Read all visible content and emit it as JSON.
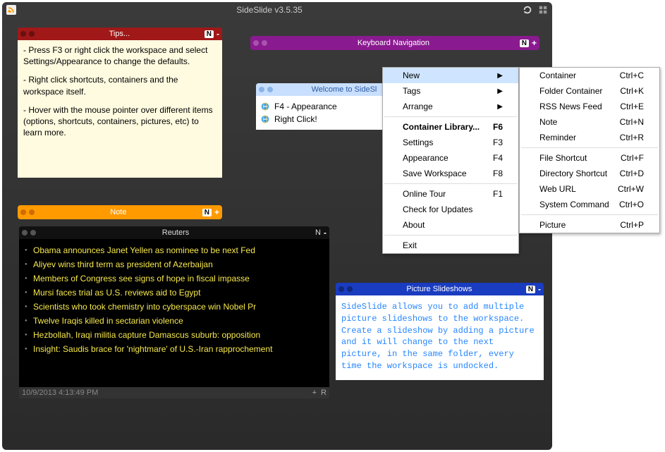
{
  "app": {
    "title": "SideSlide v3.5.35"
  },
  "tips": {
    "title": "Tips...",
    "badge": "N",
    "sign": "-",
    "paragraphs": [
      "- Press F3 or right click the workspace and select Settings/Appearance to change the defaults.",
      "- Right click shortcuts, containers and the workspace itself.",
      "- Hover with the mouse pointer over different items (options, shortcuts, containers, pictures, etc) to learn more."
    ]
  },
  "kbnav": {
    "title": "Keyboard Navigation",
    "badge": "N",
    "sign": "+"
  },
  "welcome": {
    "title": "Welcome to SideSl",
    "items": [
      {
        "label": "F4 - Appearance"
      },
      {
        "label": "Right Click!"
      }
    ]
  },
  "notebar": {
    "title": "Note",
    "badge": "N",
    "sign": "+"
  },
  "reuters": {
    "title": "Reuters",
    "badge": "N",
    "sign": "-",
    "items": [
      "Obama announces Janet Yellen as nominee to be next Fed",
      "Aliyev wins third term as president of Azerbaijan",
      "Members of Congress see signs of hope in fiscal impasse",
      "Mursi faces trial as U.S. reviews aid to Egypt",
      "Scientists who took chemistry into cyberspace win Nobel Pr",
      "Twelve Iraqis killed in sectarian violence",
      "Hezbollah, Iraqi militia capture Damascus suburb: opposition",
      "Insight: Saudis brace for 'nightmare' of U.S.-Iran rapprochement"
    ],
    "timestamp": "10/9/2013 4:13:49 PM",
    "footer_icons": [
      "+",
      "R"
    ]
  },
  "slides": {
    "title": "Picture Slideshows",
    "badge": "N",
    "sign": "-",
    "text": "SideSlide allows you to add multiple picture slideshows to the workspace. Create a slideshow by adding a picture and it will change to the next picture, in the same folder, every time the workspace is undocked."
  },
  "menu1": {
    "items": [
      {
        "label": "New",
        "arrow": true,
        "hover": true
      },
      {
        "label": "Tags",
        "arrow": true
      },
      {
        "label": "Arrange",
        "arrow": true
      },
      {
        "sep": true
      },
      {
        "label": "Container Library...",
        "shortcut": "F6",
        "bold": true
      },
      {
        "label": "Settings",
        "shortcut": "F3"
      },
      {
        "label": "Appearance",
        "shortcut": "F4"
      },
      {
        "label": "Save Workspace",
        "shortcut": "F8"
      },
      {
        "sep": true
      },
      {
        "label": "Online Tour",
        "shortcut": "F1"
      },
      {
        "label": "Check for Updates"
      },
      {
        "label": "About"
      },
      {
        "sep": true
      },
      {
        "label": "Exit"
      }
    ]
  },
  "menu2": {
    "items": [
      {
        "label": "Container",
        "shortcut": "Ctrl+C"
      },
      {
        "label": "Folder Container",
        "shortcut": "Ctrl+K"
      },
      {
        "label": "RSS News Feed",
        "shortcut": "Ctrl+E"
      },
      {
        "label": "Note",
        "shortcut": "Ctrl+N"
      },
      {
        "label": "Reminder",
        "shortcut": "Ctrl+R"
      },
      {
        "sep": true
      },
      {
        "label": "File Shortcut",
        "shortcut": "Ctrl+F"
      },
      {
        "label": "Directory Shortcut",
        "shortcut": "Ctrl+D"
      },
      {
        "label": "Web URL",
        "shortcut": "Ctrl+W"
      },
      {
        "label": "System Command",
        "shortcut": "Ctrl+O"
      },
      {
        "sep": true
      },
      {
        "label": "Picture",
        "shortcut": "Ctrl+P"
      }
    ]
  }
}
